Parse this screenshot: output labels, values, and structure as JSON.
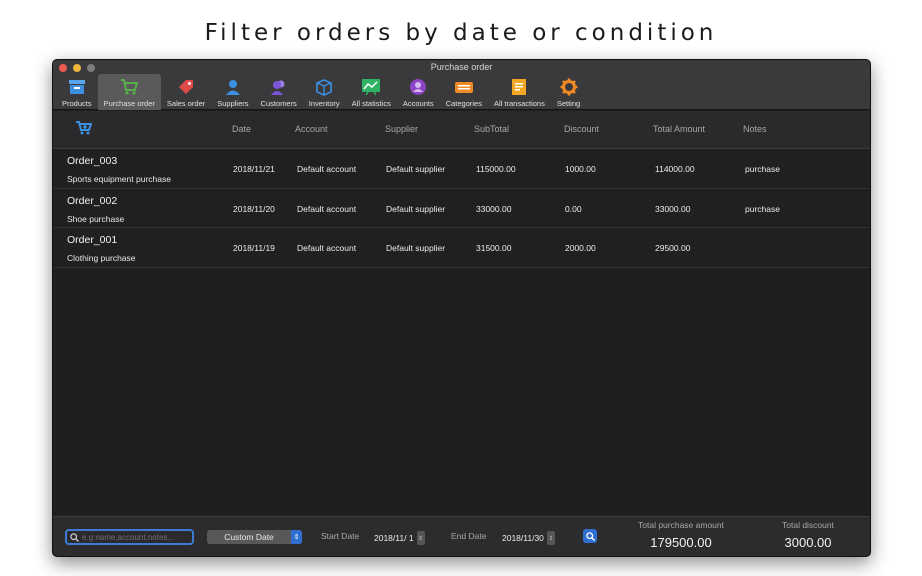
{
  "caption": "Filter orders by date or condition",
  "window": {
    "title": "Purchase order"
  },
  "toolbar": {
    "items": [
      {
        "label": "Products",
        "icon": "products-icon",
        "color": "#3d8fe0"
      },
      {
        "label": "Purchase order",
        "icon": "purchase-cart-icon",
        "color": "#56b04a",
        "active": true
      },
      {
        "label": "Sales order",
        "icon": "sales-tag-icon",
        "color": "#e04a4a"
      },
      {
        "label": "Suppliers",
        "icon": "supplier-person-icon",
        "color": "#3d8fe0"
      },
      {
        "label": "Customers",
        "icon": "customers-icon",
        "color": "#7b56d6"
      },
      {
        "label": "Inventory",
        "icon": "inventory-box-icon",
        "color": "#3d8fe0"
      },
      {
        "label": "All statistics",
        "icon": "statistics-chart-icon",
        "color": "#2fb463"
      },
      {
        "label": "Accounts",
        "icon": "accounts-icon",
        "color": "#8e44c6"
      },
      {
        "label": "Categories",
        "icon": "categories-icon",
        "color": "#f08a24"
      },
      {
        "label": "All transactions",
        "icon": "transactions-icon",
        "color": "#f0a824"
      },
      {
        "label": "Setting",
        "icon": "gear-icon",
        "color": "#f08a24"
      }
    ]
  },
  "table": {
    "headers": [
      "Date",
      "Account",
      "Supplier",
      "SubTotal",
      "Discount",
      "Total Amount",
      "Notes"
    ],
    "rows": [
      {
        "name": "Order_003",
        "desc": "Sports equipment purchase",
        "date": "2018/11/21",
        "account": "Default account",
        "supplier": "Default supplier",
        "subtotal": "115000.00",
        "discount": "1000.00",
        "total": "114000.00",
        "notes": "purchase"
      },
      {
        "name": "Order_002",
        "desc": "Shoe purchase",
        "date": "2018/11/20",
        "account": "Default account",
        "supplier": "Default supplier",
        "subtotal": "33000.00",
        "discount": "0.00",
        "total": "33000.00",
        "notes": "purchase"
      },
      {
        "name": "Order_001",
        "desc": "Clothing purchase",
        "date": "2018/11/19",
        "account": "Default account",
        "supplier": "Default supplier",
        "subtotal": "31500.00",
        "discount": "2000.00",
        "total": "29500.00",
        "notes": ""
      }
    ]
  },
  "footer": {
    "search_placeholder": "e.g:name,account,notes...",
    "filter_select": "Custom Date",
    "start_label": "Start Date",
    "start_value": "2018/11/ 1",
    "end_label": "End Date",
    "end_value": "2018/11/30",
    "total_purchase_label": "Total purchase amount",
    "total_purchase_value": "179500.00",
    "total_discount_label": "Total discount",
    "total_discount_value": "3000.00"
  }
}
